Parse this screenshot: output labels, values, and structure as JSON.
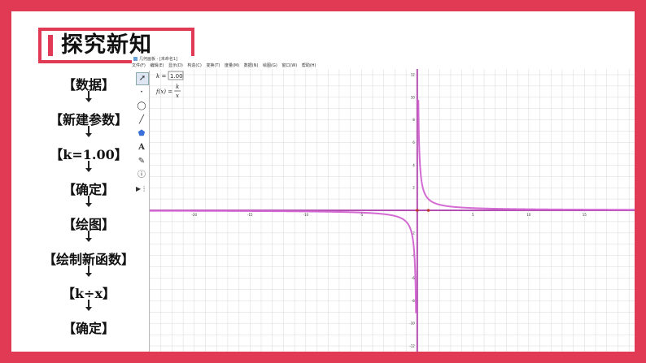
{
  "section_title": "探究新知",
  "steps": [
    "【数据】",
    "【新建参数】",
    "【k=1.00】",
    "【确定】",
    "【绘图】",
    "【绘制新函数】",
    "【k÷x】",
    "【确定】"
  ],
  "app": {
    "title": "几何画板 - [未命名1]",
    "menu": [
      "文件(F)",
      "编辑(E)",
      "显示(D)",
      "构造(C)",
      "变换(T)",
      "度量(M)",
      "数据(N)",
      "绘图(G)",
      "窗口(W)",
      "帮助(H)"
    ],
    "tools": [
      "select-arrow",
      "point",
      "compass-circle",
      "straightedge",
      "polygon",
      "text",
      "marker",
      "information",
      "custom-tool"
    ],
    "param_label": "k =",
    "param_value": "1.00",
    "function_label": "f(x) =",
    "function_numerator": "k",
    "function_denominator": "x"
  },
  "chart_data": {
    "type": "line",
    "function": "f(x) = k/x",
    "k": 1.0,
    "xlim": [
      -24,
      19.5
    ],
    "ylim": [
      -12.5,
      12.5
    ],
    "grid": true,
    "x_ticks": [
      -20,
      -15,
      -10,
      -5,
      5,
      10,
      15
    ],
    "y_ticks": [
      -12,
      -10,
      -8,
      -6,
      -4,
      -2,
      2,
      4,
      6,
      8,
      10,
      12
    ],
    "points": [
      [
        0,
        0
      ],
      [
        1,
        0
      ]
    ],
    "series": [
      {
        "values_sample": [
          [
            -24,
            -0.042
          ],
          [
            -10,
            -0.1
          ],
          [
            -5,
            -0.2
          ],
          [
            -2,
            -0.5
          ],
          [
            -1,
            -1
          ],
          [
            -0.5,
            -2
          ],
          [
            -0.2,
            -5
          ],
          [
            -0.1,
            -10
          ],
          [
            0.1,
            10
          ],
          [
            0.2,
            5
          ],
          [
            0.5,
            2
          ],
          [
            1,
            1
          ],
          [
            2,
            0.5
          ],
          [
            5,
            0.2
          ],
          [
            10,
            0.1
          ],
          [
            19.5,
            0.051
          ]
        ]
      }
    ],
    "colors": {
      "curve": "#d36bd3",
      "axis": "#b34eb3",
      "points": "#c0392b",
      "grid": "#d8d8d8"
    }
  }
}
